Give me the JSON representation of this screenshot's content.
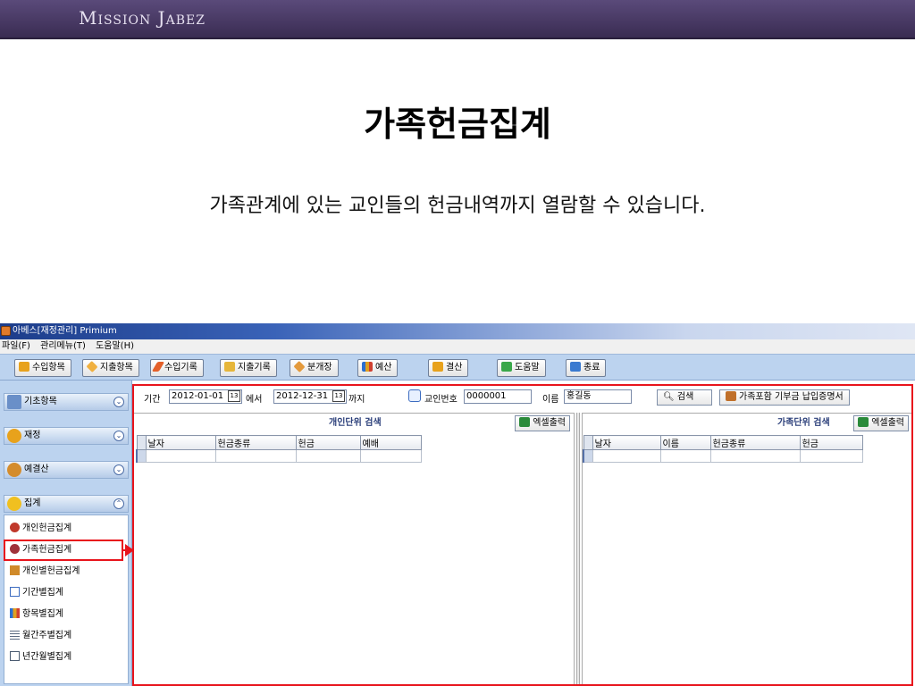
{
  "slide": {
    "brand": "Mission Jabez",
    "title": "가족헌금집계",
    "subtitle": "가족관계에 있는 교인들의 헌금내역까지 열람할 수 있습니다."
  },
  "app": {
    "title": "아베스[재정관리] Primium",
    "menu": [
      "파일(F)",
      "관리메뉴(T)",
      "도움말(H)"
    ],
    "toolbar": [
      {
        "label": "수입항목",
        "icon": "coins-icon",
        "color": "#e8a21c"
      },
      {
        "label": "지출항목",
        "icon": "diamond-icon",
        "color": "#f0b040"
      },
      {
        "label": "수입기록",
        "icon": "pencil-icon",
        "color": "#e4602a"
      },
      {
        "label": "지출기록",
        "icon": "check-icon",
        "color": "#e6b63a"
      },
      {
        "label": "분개장",
        "icon": "diamond-icon",
        "color": "#e49a3c"
      },
      {
        "label": "예산",
        "icon": "bar-chart-icon",
        "color": "#d9901a"
      },
      {
        "label": "결산",
        "icon": "coins-icon",
        "color": "#e8a21c"
      },
      {
        "label": "도움말",
        "icon": "sprout-icon",
        "color": "#3aa84a"
      },
      {
        "label": "종료",
        "icon": "exit-icon",
        "color": "#3a7ad0"
      }
    ],
    "sidebar": {
      "sections": [
        {
          "label": "기초항목",
          "icon": "notepad-icon",
          "color": "#6a8fc8",
          "expanded": false
        },
        {
          "label": "재정",
          "icon": "coins-icon",
          "color": "#e8a21c",
          "expanded": false
        },
        {
          "label": "예결산",
          "icon": "pie-icon",
          "color": "#d48c2c",
          "expanded": false
        },
        {
          "label": "집계",
          "icon": "coins-icon",
          "color": "#f0c020",
          "expanded": true
        }
      ],
      "items": [
        {
          "label": "개인헌금집계",
          "icon": "person-icon",
          "color": "#c0392b"
        },
        {
          "label": "가족헌금집계",
          "icon": "family-icon",
          "color": "#a0323a"
        },
        {
          "label": "개인별헌금집계",
          "icon": "card-icon",
          "color": "#d08a2a"
        },
        {
          "label": "기간별집계",
          "icon": "line-chart-icon",
          "color": "#3c6cc0"
        },
        {
          "label": "항목별집계",
          "icon": "bar-chart-icon",
          "color": "#2c6fd0"
        },
        {
          "label": "월간주별집계",
          "icon": "grid-icon",
          "color": "#5a6a80"
        },
        {
          "label": "년간월별집계",
          "icon": "calendar-icon",
          "color": "#4a5a70"
        }
      ]
    },
    "search": {
      "period_label": "기간",
      "start_date": "2012-01-01",
      "from_label": "에서",
      "end_date": "2012-12-31",
      "to_label": "까지",
      "member_no_label": "교인번호",
      "member_no": "0000001",
      "name_label": "이름",
      "name": "홍길동",
      "search_button": "검색",
      "certificate_button": "가족포함 기부금 납입증명서",
      "calendar_glyph": "13"
    },
    "left_panel": {
      "title": "개인단위 검색",
      "excel_button": "엑셀출력",
      "columns": [
        "날자",
        "헌금종류",
        "헌금",
        "예배"
      ]
    },
    "right_panel": {
      "title": "가족단위 검색",
      "excel_button": "엑셀출력",
      "columns": [
        "날자",
        "이름",
        "헌금종류",
        "헌금"
      ]
    }
  }
}
